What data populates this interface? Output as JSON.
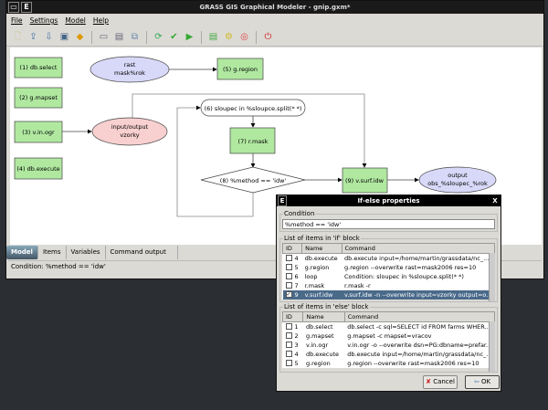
{
  "window": {
    "title": "GRASS GIS Graphical Modeler - gnip.gxm*",
    "icon_label": "E"
  },
  "menu": [
    "File",
    "Settings",
    "Model",
    "Help"
  ],
  "toolbar": [
    "new-model",
    "open-model",
    "save-model",
    "export-image",
    "export-python",
    "add-command",
    "add-data",
    "add-relation",
    "run-model",
    "validate-model",
    "run",
    "variables",
    "settings",
    "help",
    "quit"
  ],
  "diagram": {
    "nodes": [
      {
        "id": "1",
        "label": "(1) db.select",
        "type": "action"
      },
      {
        "id": "2",
        "label": "(2) g.mapset",
        "type": "action"
      },
      {
        "id": "3",
        "label": "(3) v.in.ogr",
        "type": "action"
      },
      {
        "id": "4",
        "label": "(4) db.execute",
        "type": "action"
      },
      {
        "id": "rast",
        "label1": "rast",
        "label2": "mask%rok",
        "type": "data"
      },
      {
        "id": "5",
        "label": "(5) g.region",
        "type": "action"
      },
      {
        "id": "vz",
        "label1": "input/output",
        "label2": "vzorky",
        "type": "data-io"
      },
      {
        "id": "6",
        "label": "(6) sloupec in %sloupce.split(* *)",
        "type": "loop"
      },
      {
        "id": "7",
        "label": "(7) r.mask",
        "type": "action"
      },
      {
        "id": "8",
        "label": "(8) %method == 'idw'",
        "type": "condition"
      },
      {
        "id": "9",
        "label": "(9) v.surf.idw",
        "type": "action"
      },
      {
        "id": "out",
        "label1": "output",
        "label2": "obs_%sloupec_%rok",
        "type": "data"
      }
    ],
    "colors": {
      "action": "#b0e8a0",
      "data": "#d8d8f8",
      "data_io": "#f8d0d0"
    }
  },
  "tabs": {
    "items": [
      "Model",
      "Items",
      "Variables",
      "Command output"
    ],
    "active": "Model"
  },
  "status": "Condition: %method == 'idw'",
  "dialog": {
    "title": "If-else properties",
    "icon_label": "E",
    "close": "X",
    "condition_label": "Condition",
    "condition_value": "%method == 'idw'",
    "if_label": "List of items in 'if' block",
    "else_label": "List of items in 'else' block",
    "columns": [
      "ID",
      "Name",
      "Command"
    ],
    "if_rows": [
      {
        "checked": false,
        "id": "4",
        "name": "db.execute",
        "command": "db.execute input=/home/martin/grassdata/nc_..."
      },
      {
        "checked": false,
        "id": "5",
        "name": "g.region",
        "command": "g.region --overwrite rast=mask2006 res=10"
      },
      {
        "checked": false,
        "id": "6",
        "name": "loop",
        "command": "Condition: sloupec in %sloupce.split(* *)"
      },
      {
        "checked": false,
        "id": "7",
        "name": "r.mask",
        "command": "r.mask -r"
      },
      {
        "checked": true,
        "id": "9",
        "name": "v.surf.idw",
        "command": "v.surf.idw -n --overwrite input=vzorky output=o...",
        "selected": true
      }
    ],
    "else_rows": [
      {
        "checked": false,
        "id": "1",
        "name": "db.select",
        "command": "db.select -c sql=SELECT id FROM farms WHER..."
      },
      {
        "checked": false,
        "id": "2",
        "name": "g.mapset",
        "command": "g.mapset -c mapset=vracov"
      },
      {
        "checked": false,
        "id": "3",
        "name": "v.in.ogr",
        "command": "v.in.ogr -o --overwrite dsn=PG:dbname=prefar..."
      },
      {
        "checked": false,
        "id": "4",
        "name": "db.execute",
        "command": "db.execute input=/home/martin/grassdata/nc_..."
      },
      {
        "checked": false,
        "id": "5",
        "name": "g.region",
        "command": "g.region --overwrite rast=mask2006 res=10"
      }
    ],
    "cancel": "Cancel",
    "ok": "OK"
  }
}
